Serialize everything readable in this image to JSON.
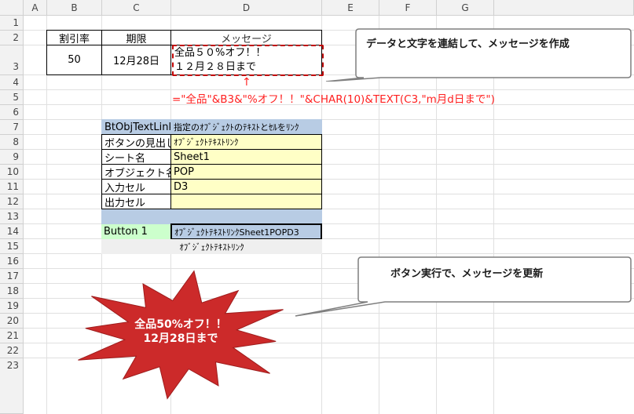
{
  "columns": [
    "A",
    "B",
    "C",
    "D",
    "E",
    "F",
    "G"
  ],
  "rows": [
    "1",
    "2",
    "3",
    "4",
    "5",
    "6",
    "7",
    "8",
    "9",
    "10",
    "11",
    "12",
    "13",
    "14",
    "15",
    "16",
    "17",
    "18",
    "19",
    "20",
    "21",
    "22",
    "23"
  ],
  "table_top": {
    "header_b": "割引率",
    "header_c": "期限",
    "header_d": "メッセージ",
    "value_b": "50",
    "value_c": "12月28日",
    "message_line1": "全品５０%オフ！！",
    "message_line2": "１２月２８日まで"
  },
  "formula": "=\"全品\"&B3&\"%オフ！！\"&CHAR(10)&TEXT(C3,\"m月d日まで\")",
  "arrow_glyph": "↑",
  "settings": {
    "title_b": "BtObjTextLink",
    "title_d": "指定のｵﾌﾞｼﾞｪｸﾄのﾃｷｽﾄとｾﾙをﾘﾝｸ",
    "rows": [
      {
        "label": "ボタンの見出し",
        "value": "ｵﾌﾞｼﾞｪｸﾄﾃｷｽﾄﾘﾝｸ",
        "small": true
      },
      {
        "label": "シート名",
        "value": "Sheet1",
        "small": false
      },
      {
        "label": "オブジェクト名",
        "value": "POP",
        "small": false
      },
      {
        "label": "入力セル",
        "value": "D3",
        "small": false
      },
      {
        "label": "出力セル",
        "value": "",
        "small": false
      }
    ],
    "button_label": "Button 1",
    "concat_value": "ｵﾌﾞｼﾞｪｸﾄﾃｷｽﾄﾘﾝｸSheet1POPD3",
    "caption": "ｵﾌﾞｼﾞｪｸﾄﾃｷｽﾄﾘﾝｸ"
  },
  "callouts": {
    "top": "データと文字を連結して、メッセージを作成",
    "bottom": "ボタン実行で、メッセージを更新"
  },
  "starburst": {
    "line1": "全品50%オフ！！",
    "line2": "12月28日まで",
    "fill": "#cc2a2a"
  }
}
